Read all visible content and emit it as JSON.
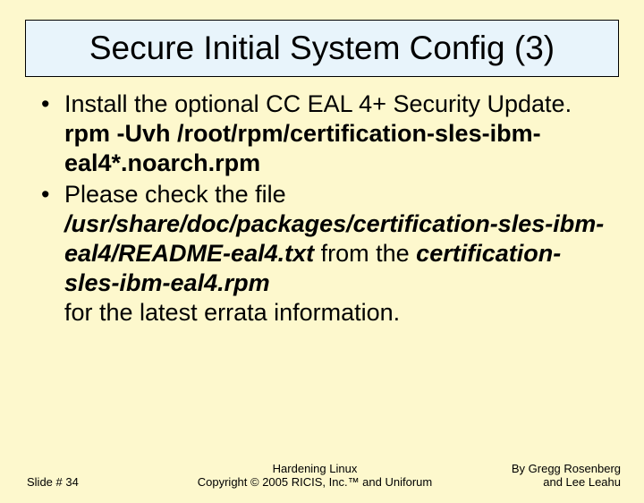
{
  "title": "Secure Initial System Config (3)",
  "bullets": [
    {
      "text_a": "Install the optional CC EAL 4+ Security Update.",
      "cmd": "rpm -Uvh /root/rpm/certification-sles-ibm-eal4*.noarch.rpm"
    },
    {
      "text_a": "Please check the file ",
      "path1": "/usr/share/doc/packages/certification-sles-ibm-eal4/README-eal4.txt",
      "text_b": " from the ",
      "path2": "certification-sles-ibm-eal4.rpm",
      "text_c": "for the latest errata information."
    }
  ],
  "footer": {
    "left": "Slide # 34",
    "center_line1": "Hardening Linux",
    "center_line2": "Copyright © 2005 RICIS, Inc.™ and Uniforum",
    "right_line1": "By Gregg Rosenberg",
    "right_line2": "and Lee Leahu"
  }
}
